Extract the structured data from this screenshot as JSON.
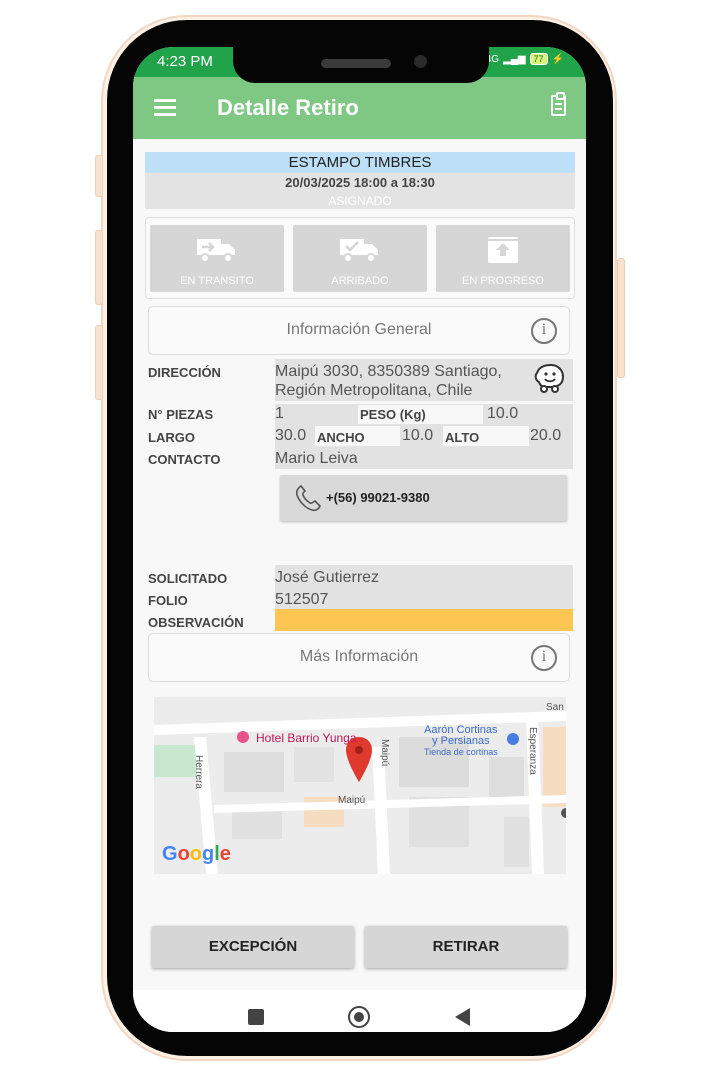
{
  "status_bar": {
    "time": "4:23 PM",
    "network": "4G",
    "battery": "77"
  },
  "app_bar": {
    "title": "Detalle Retiro"
  },
  "header": {
    "title": "ESTAMPO TIMBRES",
    "datetime": "20/03/2025 18:00 a 18:30",
    "status": "ASIGNADO"
  },
  "state_buttons": [
    {
      "label": "EN TRANSITO",
      "icon": "truck-arrow-icon"
    },
    {
      "label": "ARRIBADO",
      "icon": "truck-check-icon"
    },
    {
      "label": "EN PROGRESO",
      "icon": "box-upload-icon"
    }
  ],
  "info_general": {
    "title": "Información General"
  },
  "details": {
    "direccion_label": "DIRECCIÓN",
    "direccion_value_line1": "Maipú 3030, 8350389 Santiago,",
    "direccion_value_line2": "Región Metropolitana, Chile",
    "piezas_label": "N° PIEZAS",
    "piezas_value": "1",
    "peso_label": "PESO (Kg)",
    "peso_value": "10.0",
    "largo_label": "LARGO",
    "largo_value": "30.0",
    "ancho_label": "ANCHO",
    "ancho_value": "10.0",
    "alto_label": "ALTO",
    "alto_value": "20.0",
    "contacto_label": "CONTACTO",
    "contacto_value": "Mario Leiva",
    "phone": "+(56) 99021-9380",
    "solicitado_label": "SOLICITADO",
    "solicitado_value": "José Gutierrez",
    "folio_label": "FOLIO",
    "folio_value": "512507",
    "observacion_label": "OBSERVACIÓN",
    "observacion_value": ""
  },
  "mas_info": {
    "title": "Más Información"
  },
  "map": {
    "hotel": "Hotel Barrio Yunga",
    "store_line1": "Aarón Cortinas",
    "store_line2": "y Persianas",
    "store_sub": "Tienda de cortinas",
    "street_herrera": "Herrera",
    "street_maipu_v": "Maipú",
    "street_maipu_h": "Maipú",
    "street_esperanza": "Esperanza",
    "street_san": "San",
    "google": "Google"
  },
  "actions": {
    "exception": "EXCEPCIÓN",
    "retirar": "RETIRAR"
  },
  "colors": {
    "status_green": "#21a34a",
    "appbar_green": "#7fc884",
    "title_blue": "#bddff7",
    "observation_yellow": "#fdc653"
  }
}
